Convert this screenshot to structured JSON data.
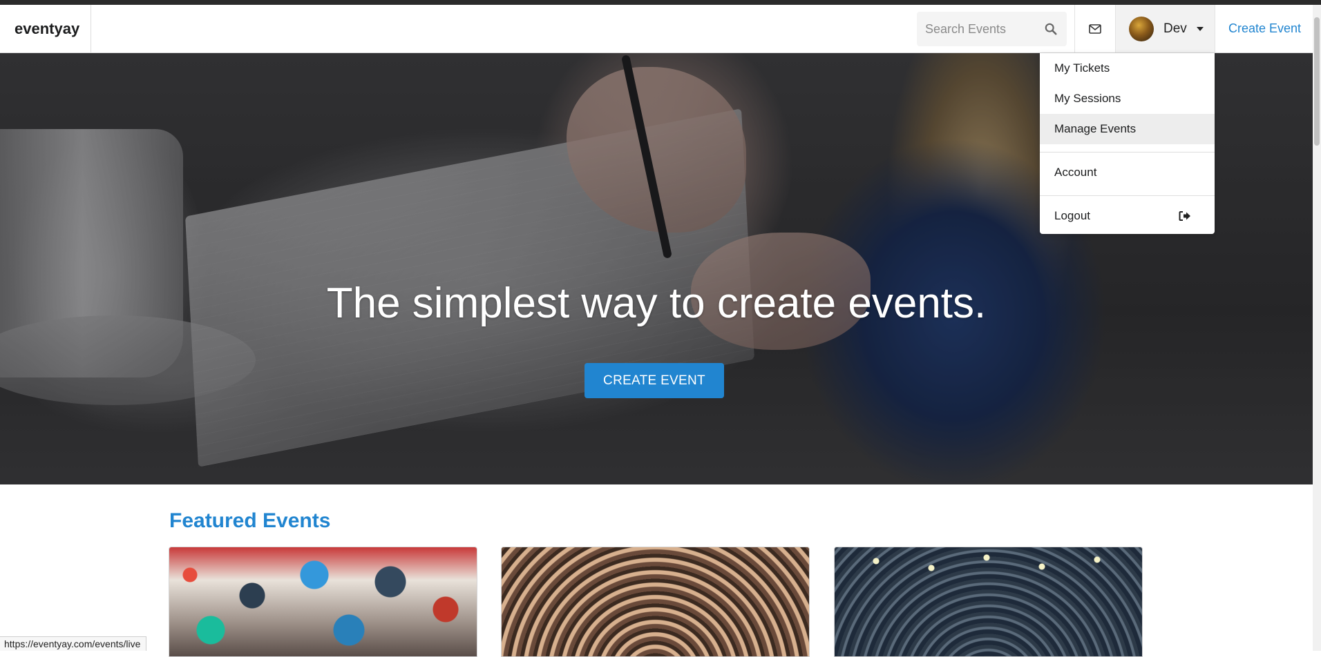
{
  "navbar": {
    "brand": "eventyay",
    "search_placeholder": "Search Events",
    "user_name": "Dev",
    "create_event_link": "Create Event"
  },
  "user_menu": {
    "items": [
      {
        "label": "My Tickets"
      },
      {
        "label": "My Sessions"
      },
      {
        "label": "Manage Events",
        "active": true
      },
      {
        "label": "Account"
      },
      {
        "label": "Logout"
      }
    ]
  },
  "hero": {
    "title": "The simplest way to create events.",
    "button_label": "CREATE EVENT"
  },
  "featured": {
    "title": "Featured Events"
  },
  "status_bar": {
    "url": "https://eventyay.com/events/live"
  },
  "colors": {
    "accent": "#2185d0"
  }
}
